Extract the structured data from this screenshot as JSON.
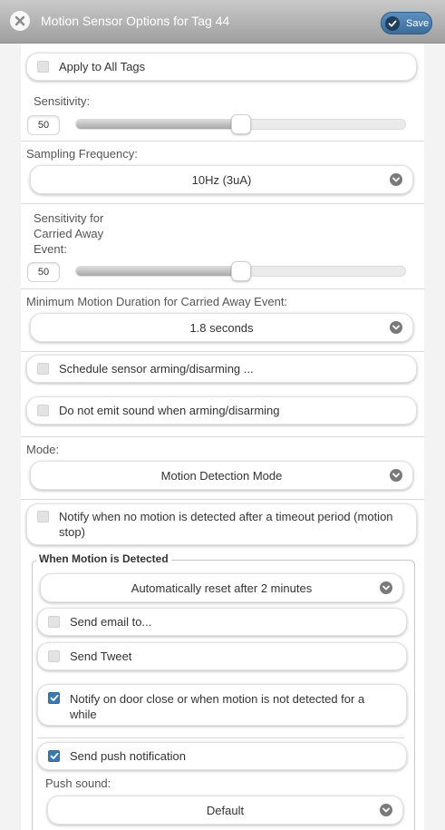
{
  "header": {
    "title": "Motion Sensor Options for Tag 44",
    "save_label": "Save"
  },
  "apply_all": {
    "label": "Apply to All Tags",
    "checked": false
  },
  "sensitivity": {
    "label": "Sensitivity:",
    "value": "50",
    "level": 50
  },
  "sampling": {
    "label": "Sampling Frequency:",
    "value": "10Hz (3uA)"
  },
  "carried_away": {
    "label_lines": [
      "Sensitivity for",
      "Carried Away",
      "Event:"
    ],
    "value": "50",
    "level": 50
  },
  "min_duration": {
    "label": "Minimum Motion Duration for Carried Away Event:",
    "value": "1.8 seconds"
  },
  "schedule": {
    "label": "Schedule sensor arming/disarming ...",
    "checked": false
  },
  "no_sound": {
    "label": "Do not emit sound when arming/disarming",
    "checked": false
  },
  "mode": {
    "label": "Mode:",
    "value": "Motion Detection Mode"
  },
  "notify_timeout": {
    "label_lines": [
      "Notify when no motion is detected after a timeout period (motion",
      "stop)"
    ],
    "checked": false
  },
  "when_detected": {
    "legend": "When Motion is Detected",
    "reset_value": "Automatically reset after 2 minutes",
    "send_email": {
      "label": "Send email to...",
      "checked": false
    },
    "send_tweet": {
      "label": "Send Tweet",
      "checked": false
    },
    "notify_door": {
      "label_lines": [
        "Notify on door close or when motion is not detected for a",
        "while"
      ],
      "checked": true
    },
    "push_notification": {
      "label": "Send push notification",
      "checked": true
    },
    "push_sound": {
      "label": "Push sound:",
      "value": "Default"
    }
  },
  "colors": {
    "accent": "#3a7ab1",
    "header": "#b3b3b3"
  }
}
